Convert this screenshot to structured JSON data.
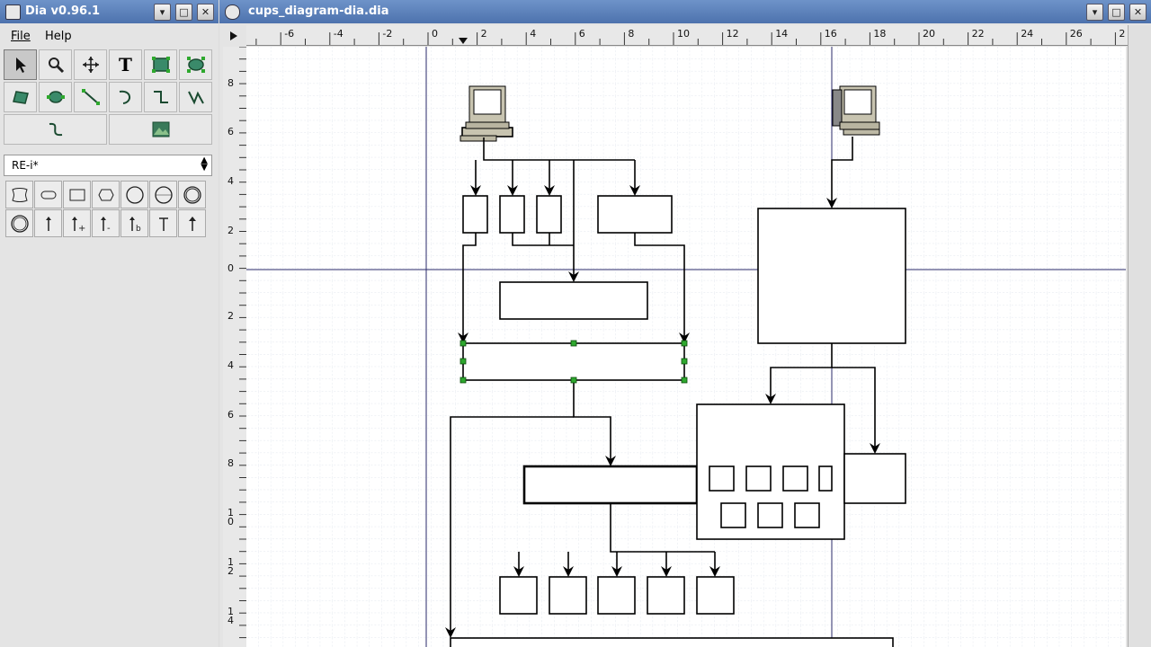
{
  "toolbox": {
    "title": "Dia v0.96.1",
    "menu": {
      "file": "File",
      "help": "Help"
    },
    "sheet": "RE-i*",
    "tools": [
      "modify-tool",
      "magnify-tool",
      "scroll-tool",
      "text-tool",
      "box-tool",
      "ellipse-tool",
      "polygon-tool",
      "beziergon-tool",
      "line-tool",
      "arc-tool",
      "zigzag-tool",
      "polyline-tool",
      "bezier-tool",
      "image-tool"
    ],
    "shapes": [
      "entity",
      "weak-entity",
      "relationship",
      "attribute",
      "key-attribute",
      "multivalued-attribute",
      "derived-attribute",
      "participation",
      "cardinality-one",
      "cardinality-many",
      "cardinality-optional",
      "isa",
      "total-participation",
      "partial-participation"
    ]
  },
  "diagram": {
    "title": "cups_diagram-dia.dia",
    "ruler_h_labels": [
      "-6",
      "-4",
      "-2",
      "0",
      "2",
      "4",
      "6",
      "8",
      "10",
      "12",
      "14",
      "16",
      "18",
      "20",
      "22",
      "24",
      "26",
      "2"
    ],
    "ruler_v_labels": [
      "8",
      "6",
      "4",
      "2",
      "0",
      "2",
      "4",
      "6",
      "8",
      "1\n0",
      "1\n2",
      "1\n4"
    ]
  },
  "colors": {
    "titlebar": "#5a7fbb",
    "selection_handle": "#2ea82e",
    "guide": "#2a2a6a"
  }
}
